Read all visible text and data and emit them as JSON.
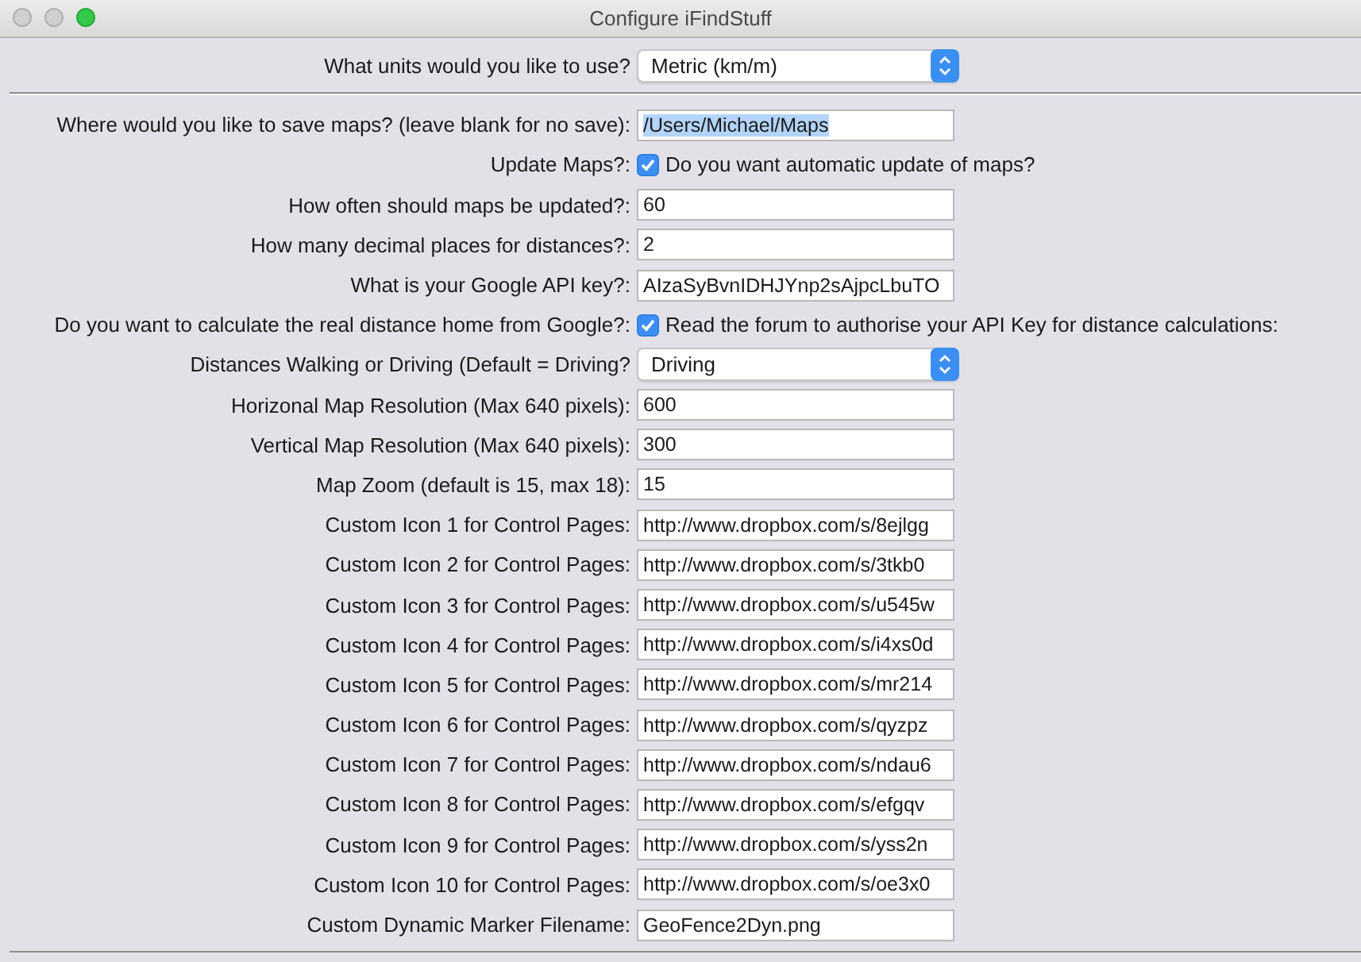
{
  "window": {
    "title": "Configure iFindStuff"
  },
  "top_rows": [
    {
      "kind": "select",
      "label": "What units would you like to use?",
      "value": "Metric (km/m)"
    }
  ],
  "rows": [
    {
      "kind": "text",
      "label": "Where would you like to save maps? (leave blank for no save):",
      "value": "/Users/Michael/Maps",
      "text_selected": true
    },
    {
      "kind": "checkbox",
      "label": "Update Maps?:",
      "text": "Do you want automatic update of maps?",
      "checked": true
    },
    {
      "kind": "text",
      "label": "How often should maps be updated?:",
      "value": "60",
      "text_selected": false
    },
    {
      "kind": "text",
      "label": "How many decimal places for distances?:",
      "value": "2",
      "text_selected": false
    },
    {
      "kind": "text",
      "label": "What is your Google API key?:",
      "value": "AIzaSyBvnIDHJYnp2sAjpcLbuTO",
      "text_selected": false
    },
    {
      "kind": "checkbox",
      "label": "Do you want to calculate the real distance home from Google?:",
      "text": "Read the forum to authorise your API Key for distance calculations:",
      "checked": true
    },
    {
      "kind": "select",
      "label": "Distances Walking or Driving (Default = Driving?",
      "value": "Driving"
    },
    {
      "kind": "text",
      "label": "Horizonal Map Resolution (Max 640 pixels):",
      "value": "600",
      "text_selected": false
    },
    {
      "kind": "text",
      "label": "Vertical Map Resolution (Max 640 pixels):",
      "value": "300",
      "text_selected": false
    },
    {
      "kind": "text",
      "label": "Map Zoom (default is 15, max 18):",
      "value": "15",
      "text_selected": false
    },
    {
      "kind": "text",
      "label": "Custom Icon 1 for Control Pages:",
      "value": "http://www.dropbox.com/s/8ejlgg",
      "text_selected": false
    },
    {
      "kind": "text",
      "label": "Custom Icon 2 for Control Pages:",
      "value": "http://www.dropbox.com/s/3tkb0",
      "text_selected": false
    },
    {
      "kind": "text",
      "label": "Custom Icon 3 for Control Pages:",
      "value": "http://www.dropbox.com/s/u545w",
      "text_selected": false
    },
    {
      "kind": "text",
      "label": "Custom Icon 4 for Control Pages:",
      "value": "http://www.dropbox.com/s/i4xs0d",
      "text_selected": false
    },
    {
      "kind": "text",
      "label": "Custom Icon 5 for Control Pages:",
      "value": "http://www.dropbox.com/s/mr214",
      "text_selected": false
    },
    {
      "kind": "text",
      "label": "Custom Icon 6 for Control Pages:",
      "value": "http://www.dropbox.com/s/qyzpz",
      "text_selected": false
    },
    {
      "kind": "text",
      "label": "Custom Icon 7 for Control Pages:",
      "value": "http://www.dropbox.com/s/ndau6",
      "text_selected": false
    },
    {
      "kind": "text",
      "label": "Custom Icon 8 for Control Pages:",
      "value": "http://www.dropbox.com/s/efgqv",
      "text_selected": false
    },
    {
      "kind": "text",
      "label": "Custom Icon 9 for Control Pages:",
      "value": "http://www.dropbox.com/s/yss2n",
      "text_selected": false
    },
    {
      "kind": "text",
      "label": "Custom Icon 10 for Control Pages:",
      "value": "http://www.dropbox.com/s/oe3x0",
      "text_selected": false
    },
    {
      "kind": "text",
      "label": "Custom Dynamic Marker Filename:",
      "value": "GeoFence2Dyn.png",
      "text_selected": false
    }
  ]
}
